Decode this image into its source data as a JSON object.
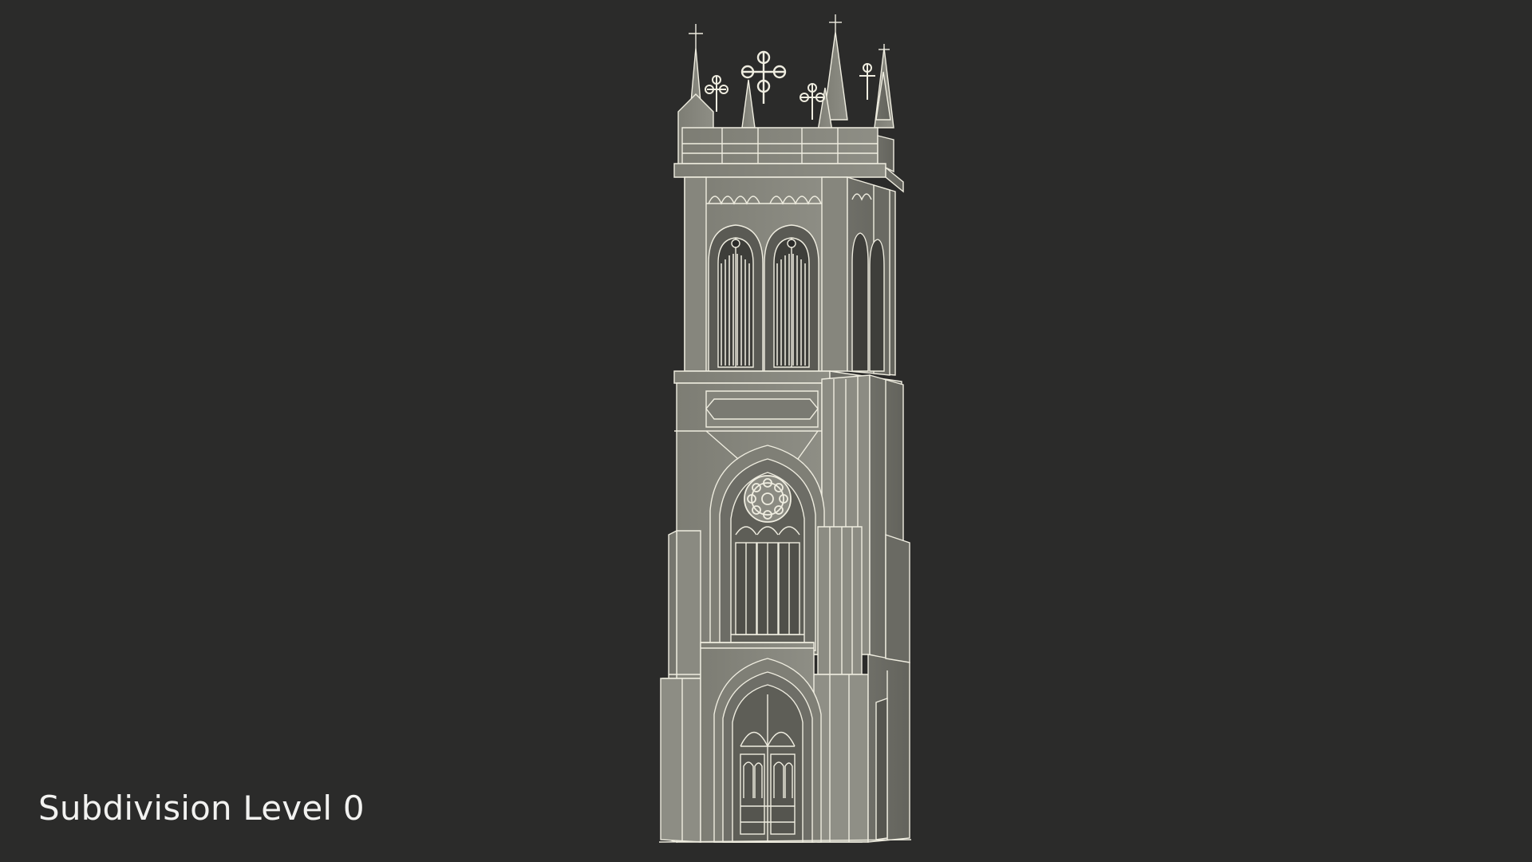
{
  "viewport": {
    "background_color": "#2b2b2a"
  },
  "model": {
    "subject": "gothic church bell tower",
    "surface_color": "#8a8a80",
    "wire_color": "#f0eee2",
    "shadow_color": "#5d5d56"
  },
  "caption": {
    "text": "Subdivision Level 0",
    "color": "#f2f2f0"
  }
}
